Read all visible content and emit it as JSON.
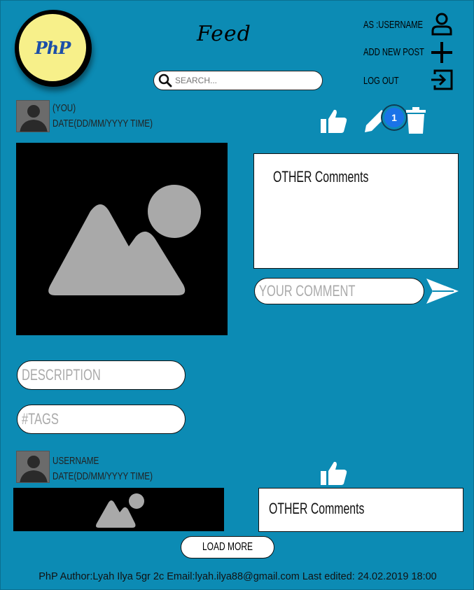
{
  "header": {
    "logo_text": "PhP",
    "title": "Feed",
    "search_placeholder": "Search...",
    "menu": {
      "username_label": "AS :USERNAME",
      "add_post_label": "ADD NEW POST",
      "logout_label": "LOG OUT"
    }
  },
  "post1": {
    "author": "(YOU)",
    "date": "DATE(DD/MM/YYYY TIME)",
    "notification_count": "1",
    "comments_label": "OTHER Comments",
    "comment_placeholder": "Your comment",
    "description_placeholder": "DESCRIPTION",
    "tags_placeholder": "#TAGS"
  },
  "post2": {
    "author": "USERNAME",
    "date": "DATE(DD/MM/YYYY TIME)",
    "comments_label": "OTHER Comments"
  },
  "load_more_label": "LOAD MORE",
  "footer": "PhP Author:Lyah Ilya 5gr 2c Email:lyah.ilya88@gmail.com Last edited: 24.02.2019 18:00",
  "colors": {
    "background": "#0c8bb4",
    "logo_fill": "#f7f08a",
    "badge": "#1a73e8"
  }
}
